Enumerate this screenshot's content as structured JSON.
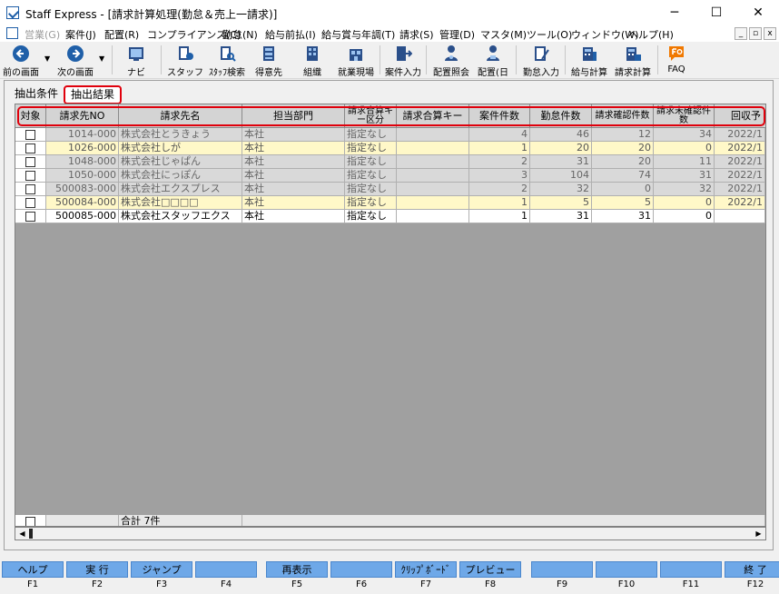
{
  "window": {
    "title": "Staff Express - [請求計算処理(勤怠＆売上一請求)]",
    "controls": [
      "─",
      "☐",
      "✕"
    ]
  },
  "menu": [
    "営業(G)",
    "案件(J)",
    "配置(R)",
    "コンプライアンス(C)",
    "勤怠(N)",
    "給与前払(I)",
    "給与賞与年調(T)",
    "請求(S)",
    "管理(D)",
    "マスタ(M)",
    "ツール(O)",
    "ウィンドウ(W)",
    "ヘルプ(H)"
  ],
  "mdi_controls": [
    "_",
    "▫",
    "x"
  ],
  "toolbar": [
    {
      "label": "前の画面",
      "icon": "arrow-left-icon"
    },
    {
      "label": "次の画面",
      "icon": "arrow-right-icon"
    },
    {
      "label": "ナビ",
      "icon": "navi-icon"
    },
    {
      "label": "スタッフ",
      "icon": "staff-icon"
    },
    {
      "label": "ｽﾀｯﾌ検索",
      "icon": "staff-search-icon"
    },
    {
      "label": "得意先",
      "icon": "customer-icon"
    },
    {
      "label": "組織",
      "icon": "organization-icon"
    },
    {
      "label": "就業現場",
      "icon": "worksite-icon"
    },
    {
      "label": "案件入力",
      "icon": "case-input-icon"
    },
    {
      "label": "配置照会",
      "icon": "placement-inquiry-icon"
    },
    {
      "label": "配置(日",
      "icon": "placement-day-icon"
    },
    {
      "label": "勤怠入力",
      "icon": "attendance-input-icon"
    },
    {
      "label": "給与計算",
      "icon": "payroll-calc-icon"
    },
    {
      "label": "請求計算",
      "icon": "billing-calc-icon"
    },
    {
      "label": "FAQ",
      "icon": "faq-icon"
    }
  ],
  "tabs": {
    "conditions": "抽出条件",
    "results": "抽出結果"
  },
  "grid": {
    "headers": [
      "対象",
      "請求先NO",
      "請求先名",
      "担当部門",
      "請求合算キー区分",
      "請求合算キー",
      "案件件数",
      "勤怠件数",
      "請求確認件数",
      "請求未確認件数",
      "回収予"
    ],
    "rows": [
      {
        "no": "1014-000",
        "name": "株式会社とうきょう",
        "dept": "本社",
        "keytype": "指定なし",
        "key": "",
        "cases": "4",
        "attend": "46",
        "confirmed": "12",
        "unconfirmed": "34",
        "collect": "2022/1",
        "style": "gray"
      },
      {
        "no": "1026-000",
        "name": "株式会社しが",
        "dept": "本社",
        "keytype": "指定なし",
        "key": "",
        "cases": "1",
        "attend": "20",
        "confirmed": "20",
        "unconfirmed": "0",
        "collect": "2022/1",
        "style": "yellow"
      },
      {
        "no": "1048-000",
        "name": "株式会社じゃぱん",
        "dept": "本社",
        "keytype": "指定なし",
        "key": "",
        "cases": "2",
        "attend": "31",
        "confirmed": "20",
        "unconfirmed": "11",
        "collect": "2022/1",
        "style": "gray"
      },
      {
        "no": "1050-000",
        "name": "株式会社にっぽん",
        "dept": "本社",
        "keytype": "指定なし",
        "key": "",
        "cases": "3",
        "attend": "104",
        "confirmed": "74",
        "unconfirmed": "31",
        "collect": "2022/1",
        "style": "gray"
      },
      {
        "no": "500083-000",
        "name": "株式会社エクスプレス",
        "dept": "本社",
        "keytype": "指定なし",
        "key": "",
        "cases": "2",
        "attend": "32",
        "confirmed": "0",
        "unconfirmed": "32",
        "collect": "2022/1",
        "style": "gray"
      },
      {
        "no": "500084-000",
        "name": "株式会社□□□□",
        "dept": "本社",
        "keytype": "指定なし",
        "key": "",
        "cases": "1",
        "attend": "5",
        "confirmed": "5",
        "unconfirmed": "0",
        "collect": "2022/1",
        "style": "yellow"
      },
      {
        "no": "500085-000",
        "name": "株式会社スタッフエクス",
        "dept": "本社",
        "keytype": "指定なし",
        "key": "",
        "cases": "1",
        "attend": "31",
        "confirmed": "31",
        "unconfirmed": "0",
        "collect": "",
        "style": "white"
      }
    ],
    "total_label": "合計 7件"
  },
  "fkeys": [
    {
      "label": "ヘルプ",
      "key": "F1"
    },
    {
      "label": "実 行",
      "key": "F2"
    },
    {
      "label": "ジャンプ",
      "key": "F3"
    },
    {
      "label": "",
      "key": "F4"
    },
    {
      "label": "再表示",
      "key": "F5"
    },
    {
      "label": "",
      "key": "F6"
    },
    {
      "label": "ｸﾘｯﾌﾟﾎﾞｰﾄﾞ",
      "key": "F7"
    },
    {
      "label": "プレビュー",
      "key": "F8"
    },
    {
      "label": "",
      "key": "F9"
    },
    {
      "label": "",
      "key": "F10"
    },
    {
      "label": "",
      "key": "F11"
    },
    {
      "label": "終 了",
      "key": "F12"
    }
  ],
  "colors": {
    "accent": "#e0000c",
    "fkey": "#6ea8e8",
    "row_gray": "#d9d9d9",
    "row_yellow": "#fff8c8",
    "row_white": "#ffffff"
  }
}
